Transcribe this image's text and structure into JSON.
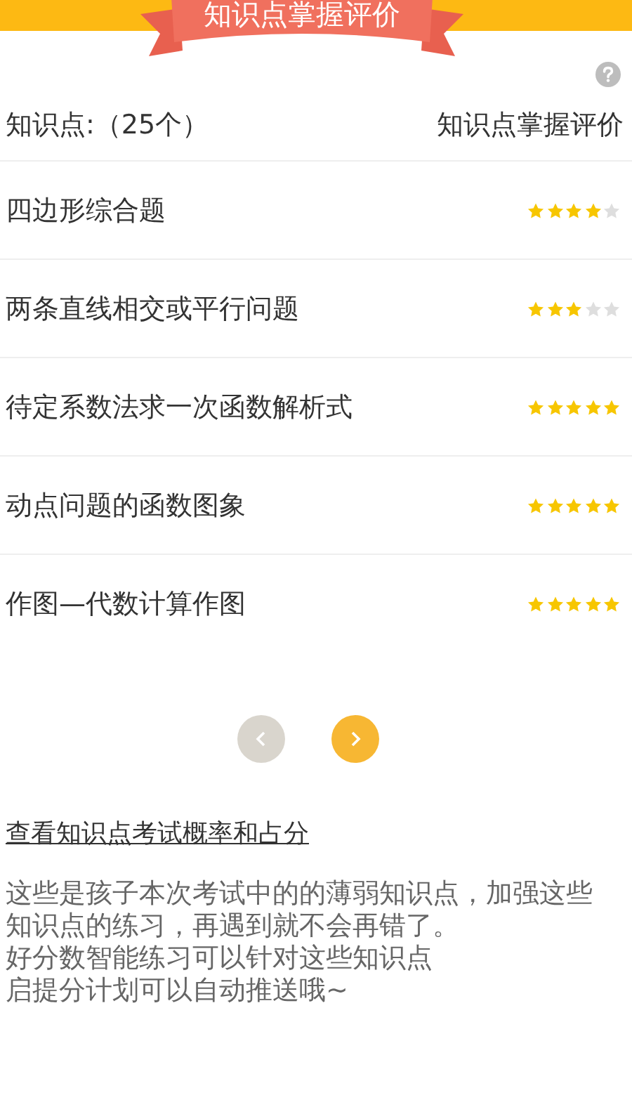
{
  "banner": {
    "title": "知识点掌握评价"
  },
  "header": {
    "count_label": "知识点:（25个）",
    "rating_label": "知识点掌握评价"
  },
  "items": [
    {
      "name": "四边形综合题",
      "stars": 4
    },
    {
      "name": "两条直线相交或平行问题",
      "stars": 3
    },
    {
      "name": "待定系数法求一次函数解析式",
      "stars": 5
    },
    {
      "name": "动点问题的函数图象",
      "stars": 5
    },
    {
      "name": "作图—代数计算作图",
      "stars": 5
    }
  ],
  "pager": [
    {
      "kind": "prev",
      "disabled": true
    },
    {
      "kind": "next",
      "disabled": false
    }
  ],
  "link": "查看知识点考试概率和占分",
  "notes": [
    "这些是孩子本次考试中的的薄弱知识点，加强这些知识点的练习，再遇到就不会再错了。",
    "好分数智能练习可以针对这些知识点",
    "启提分计划可以自动推送哦~"
  ]
}
